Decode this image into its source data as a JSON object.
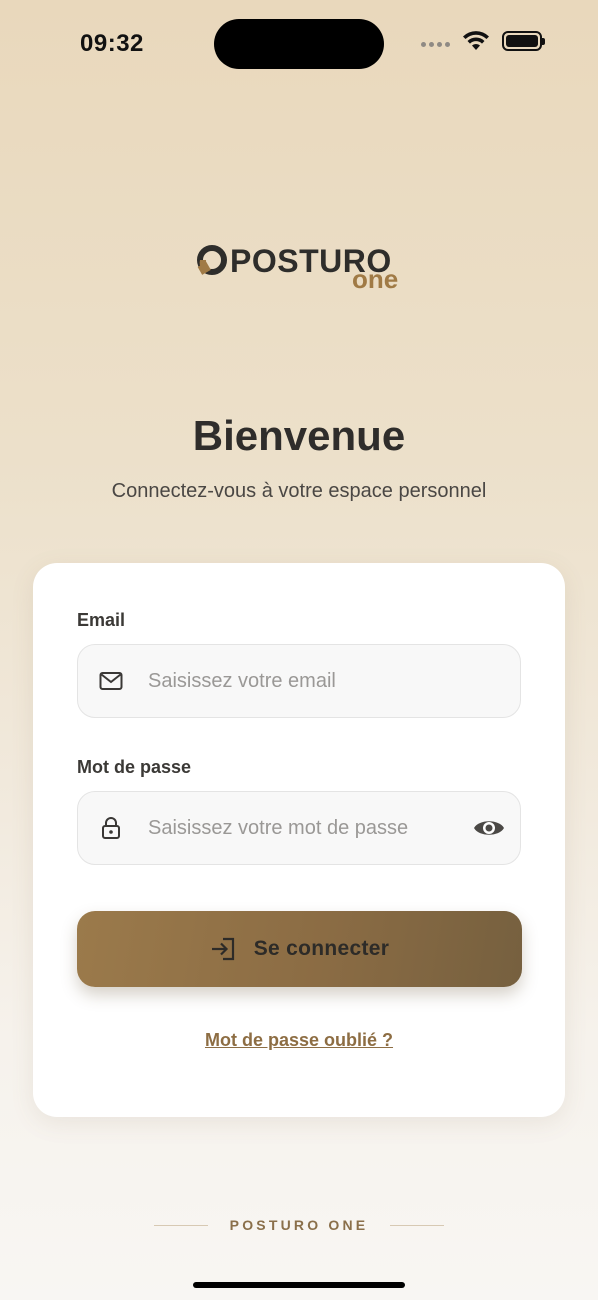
{
  "status_bar": {
    "time": "09:32",
    "icons": [
      "signal-dots-icon",
      "wifi-icon",
      "battery-icon"
    ]
  },
  "logo": {
    "word": "POSTURO",
    "sub": "one",
    "accent_color": "#a07a45"
  },
  "header": {
    "title": "Bienvenue",
    "subtitle": "Connectez-vous à votre espace personnel"
  },
  "form": {
    "email": {
      "label": "Email",
      "placeholder": "Saisissez votre email",
      "value": "",
      "icon": "mail-icon"
    },
    "password": {
      "label": "Mot de passe",
      "placeholder": "Saisissez votre mot de passe",
      "value": "",
      "icon": "lock-icon",
      "toggle_icon": "eye-icon"
    },
    "submit_label": "Se connecter",
    "submit_icon": "login-icon",
    "forgot_label": "Mot de passe oublié ?"
  },
  "footer": {
    "brand": "POSTURO ONE"
  },
  "colors": {
    "accent": "#8d6d43",
    "button_gradient_start": "#9b7a4b",
    "button_gradient_end": "#76603f",
    "background_top": "#e9d8bc",
    "background_bottom": "#f8f6f3"
  }
}
